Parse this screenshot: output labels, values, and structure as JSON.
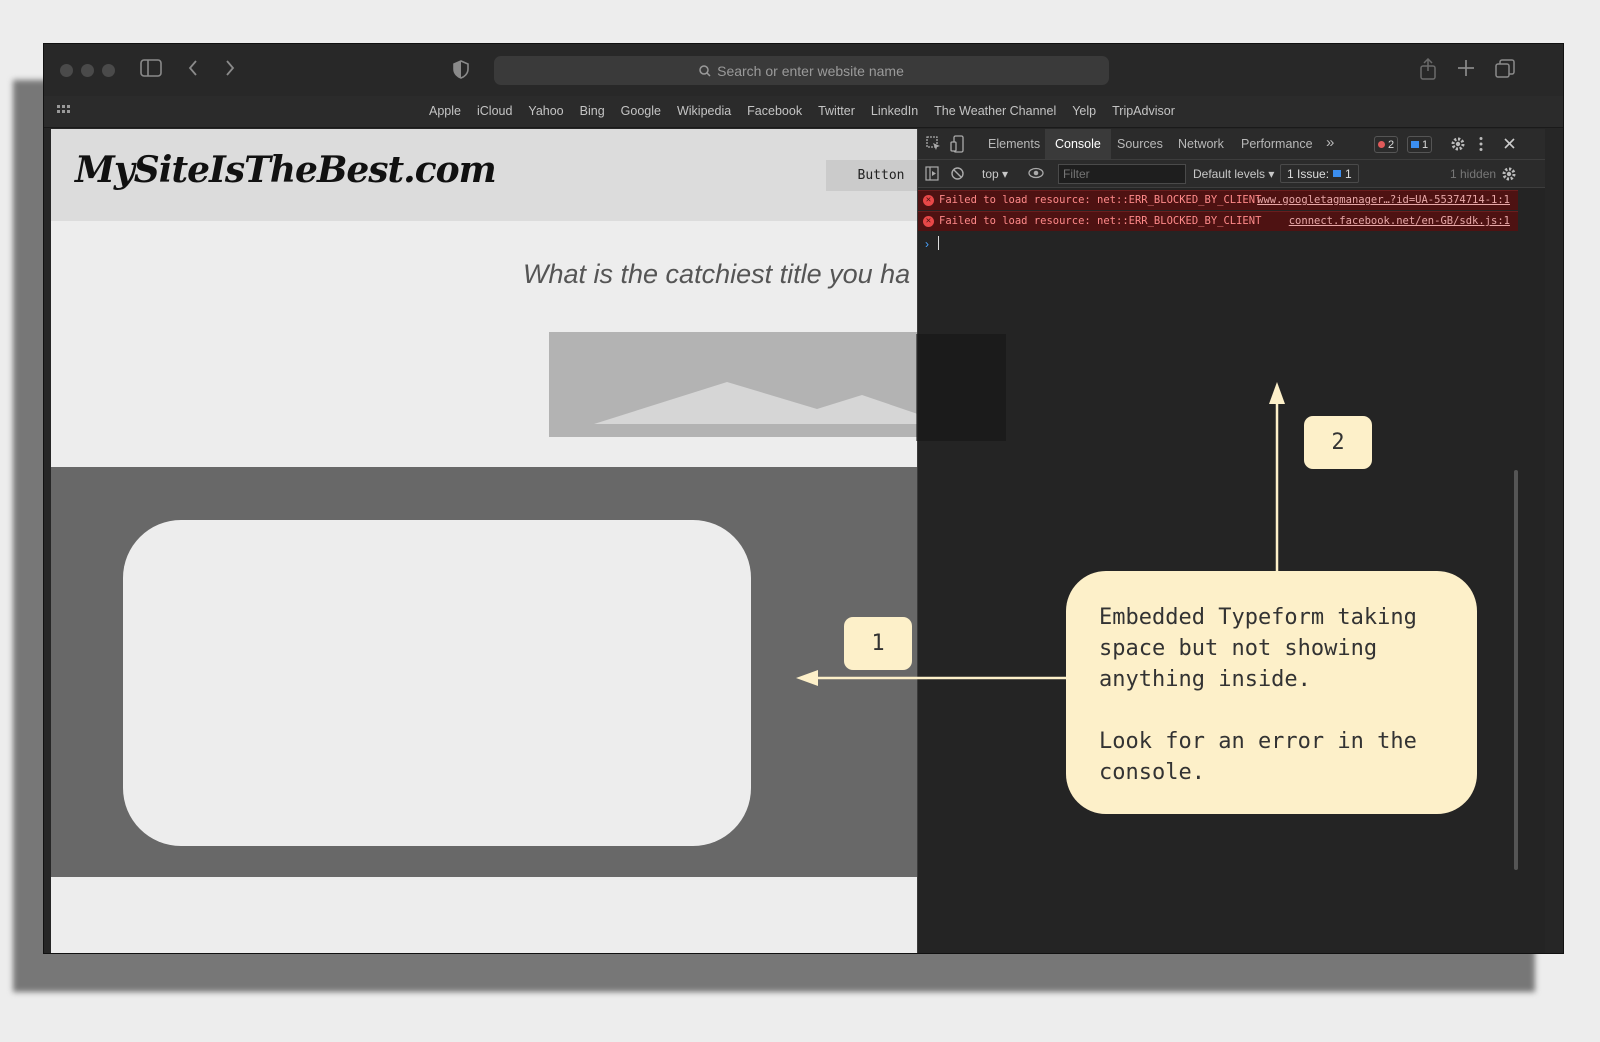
{
  "browser": {
    "url_placeholder": "Search or enter website name",
    "favorites": [
      "Apple",
      "iCloud",
      "Yahoo",
      "Bing",
      "Google",
      "Wikipedia",
      "Facebook",
      "Twitter",
      "LinkedIn",
      "The Weather Channel",
      "Yelp",
      "TripAdvisor"
    ]
  },
  "site": {
    "logo": "MySiteIsTheBest.com",
    "button_label": "Button",
    "hero_title": "What is the catchiest title you ha"
  },
  "devtools": {
    "tabs": [
      "Elements",
      "Console",
      "Sources",
      "Network",
      "Performance"
    ],
    "more_tabs": "»",
    "error_count": "2",
    "issue_count": "1",
    "context": "top ▾",
    "filter_placeholder": "Filter",
    "levels": "Default levels ▾",
    "issues_label": "1 Issue:",
    "issues_badge": "1",
    "hidden": "1 hidden",
    "errors": [
      {
        "message": "Failed to load resource: net::ERR_BLOCKED_BY_CLIENT",
        "source": "www.googletagmanager…?id=UA-55374714-1:1"
      },
      {
        "message": "Failed to load resource: net::ERR_BLOCKED_BY_CLIENT",
        "source": "connect.facebook.net/en-GB/sdk.js:1"
      }
    ],
    "prompt_symbol": "›"
  },
  "annotations": {
    "label_1": "1",
    "label_2": "2",
    "callout_line1": "Embedded Typeform taking space but not showing anything inside.",
    "callout_line2": "Look for an error in the console.",
    "color": "#fdf0c9"
  }
}
